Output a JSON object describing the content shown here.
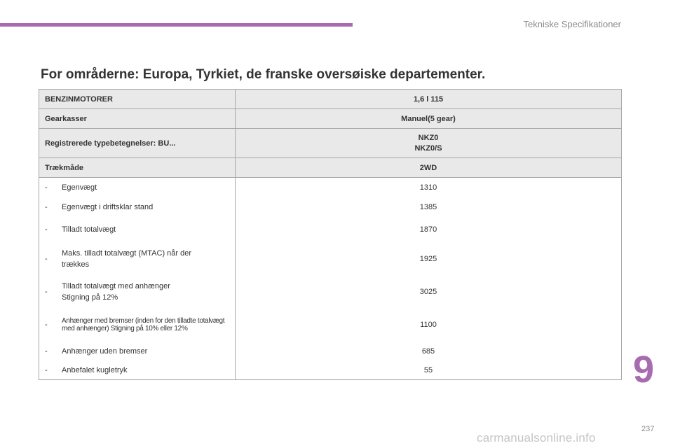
{
  "header": {
    "section_title": "Tekniske Specifikationer"
  },
  "page_heading": "For områderne: Europa, Tyrkiet, de franske oversøiske departementer.",
  "table": {
    "head_rows": [
      {
        "label": "BENZINMOTORER",
        "values": [
          "1,6 l 115"
        ]
      },
      {
        "label": "Gearkasser",
        "values": [
          "Manuel(5 gear)"
        ]
      },
      {
        "label": "Registrerede typebetegnelser: BU...",
        "values": [
          "NKZ0",
          "NKZ0/S"
        ]
      },
      {
        "label": "Trækmåde",
        "values": [
          "2WD"
        ]
      }
    ],
    "items": [
      {
        "dash": "-",
        "label": "Egenvægt",
        "value": "1310"
      },
      {
        "dash": "-",
        "label": "Egenvægt i driftsklar stand",
        "value": "1385"
      },
      {
        "dash": "-",
        "label": "Tilladt totalvægt",
        "value": "1870"
      },
      {
        "dash": "-",
        "label": "Maks. tilladt totalvægt (MTAC) når der trækkes",
        "value": "1925"
      },
      {
        "dash": "-",
        "label": "Tilladt totalvægt med anhænger Stigning på 12%",
        "value": "3025"
      },
      {
        "dash": "-",
        "label": "Anhænger med bremser (inden for den tilladte totalvægt med anhænger) Stigning på 10% eller 12%",
        "value": "1100"
      },
      {
        "dash": "-",
        "label": "Anhænger uden bremser",
        "value": "685"
      },
      {
        "dash": "-",
        "label": "Anbefalet kugletryk",
        "value": "55"
      }
    ]
  },
  "chapter_number": "9",
  "page_number": "237",
  "watermark": "carmanualsonline.info",
  "colors": {
    "accent": "#a86bb0",
    "header_row_bg": "#e9e9e9",
    "border": "#a7a7a7"
  }
}
